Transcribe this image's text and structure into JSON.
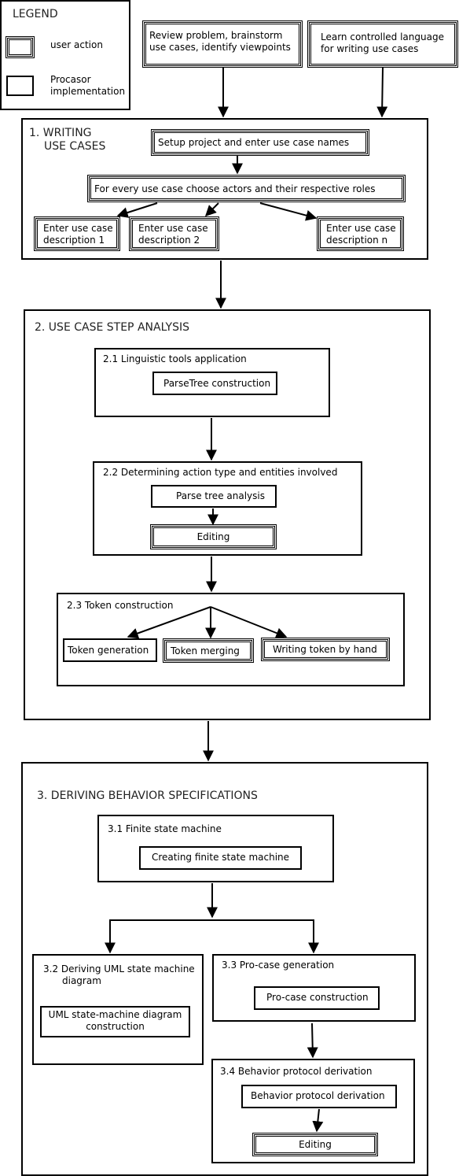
{
  "legend": {
    "title": "LEGEND",
    "user_action_label": "user action",
    "implementation_label_line1": "Procasor",
    "implementation_label_line2": "implementation"
  },
  "top": {
    "review_line1": "Review problem, brainstorm",
    "review_line2": "use cases, identify viewpoints",
    "learn_line1": "Learn controlled language",
    "learn_line2": "for writing use cases"
  },
  "section1": {
    "title_line1": "1. WRITING",
    "title_line2": "USE CASES",
    "setup": "Setup project and enter use case names",
    "actors": "For every use case choose actors and their respective roles",
    "desc1_line1": "Enter use case",
    "desc1_line2": "description 1",
    "desc2_line1": "Enter use case",
    "desc2_line2": "description 2",
    "descn_line1": "Enter use case",
    "descn_line2": "description n"
  },
  "section2": {
    "title": "2. USE CASE STEP ANALYSIS",
    "s21_title": "2.1  Linguistic tools application",
    "s21_item": "ParseTree construction",
    "s22_title": "2.2 Determining action type and entities involved",
    "s22_item1": "Parse tree analysis",
    "s22_item2": "Editing",
    "s23_title": "2.3 Token construction",
    "s23_item1": "Token generation",
    "s23_item2": "Token merging",
    "s23_item3": "Writing token by hand"
  },
  "section3": {
    "title": "3. DERIVING BEHAVIOR SPECIFICATIONS",
    "s31_title": "3.1 Finite state machine",
    "s31_item": "Creating finite state machine",
    "s32_title_line1": "3.2 Deriving UML state machine",
    "s32_title_line2": "diagram",
    "s32_item_line1": "UML state-machine diagram",
    "s32_item_line2": "construction",
    "s33_title": "3.3 Pro-case generation",
    "s33_item": "Pro-case construction",
    "s34_title": "3.4 Behavior protocol derivation",
    "s34_item1": "Behavior protocol derivation",
    "s34_item2": "Editing"
  }
}
